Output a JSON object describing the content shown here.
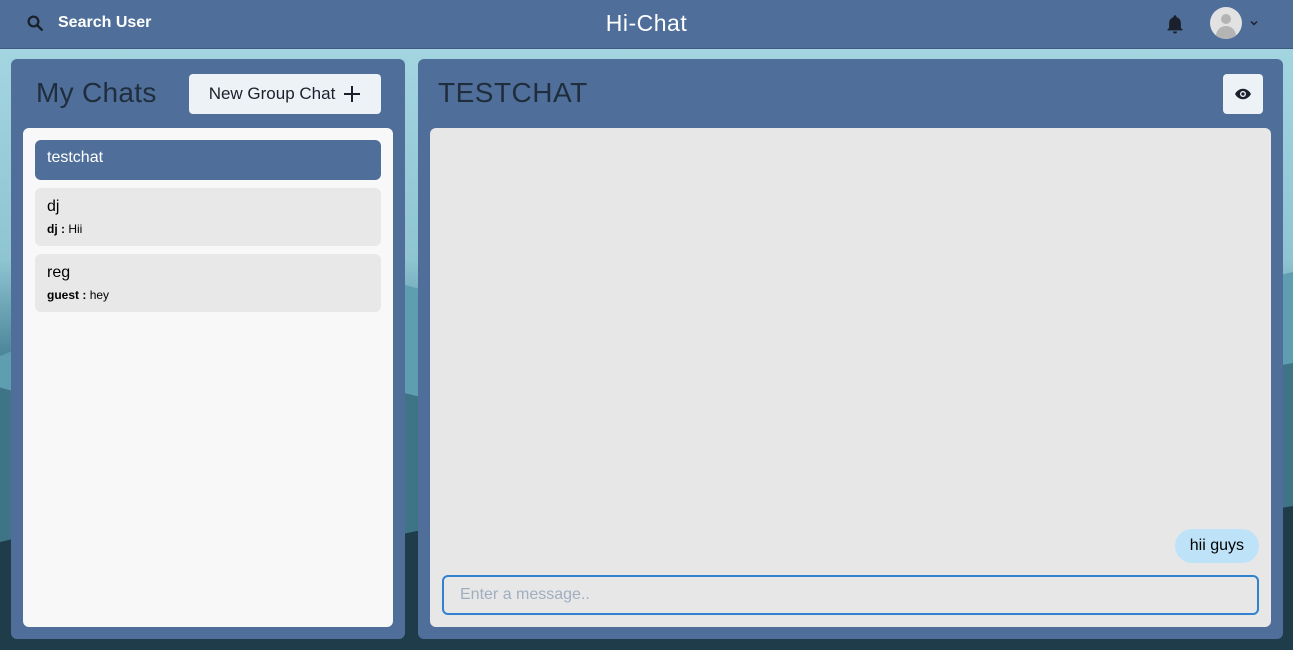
{
  "header": {
    "search_label": "Search User",
    "app_title": "Hi-Chat"
  },
  "left_panel": {
    "title": "My Chats",
    "new_group_label": "New Group Chat",
    "chats": [
      {
        "name": "testchat",
        "sender": "",
        "message": "",
        "active": true
      },
      {
        "name": "dj",
        "sender": "dj :",
        "message": "Hii",
        "active": false
      },
      {
        "name": "reg",
        "sender": "guest :",
        "message": "hey",
        "active": false
      }
    ]
  },
  "chat": {
    "title": "TESTCHAT",
    "messages": [
      {
        "text": "hii guys",
        "own": true
      }
    ],
    "input_placeholder": "Enter a message.."
  },
  "colors": {
    "panel": "#4f6f9a",
    "active_chat": "#4f6f9a",
    "bubble": "#bee3f8",
    "input_border": "#3182ce"
  }
}
